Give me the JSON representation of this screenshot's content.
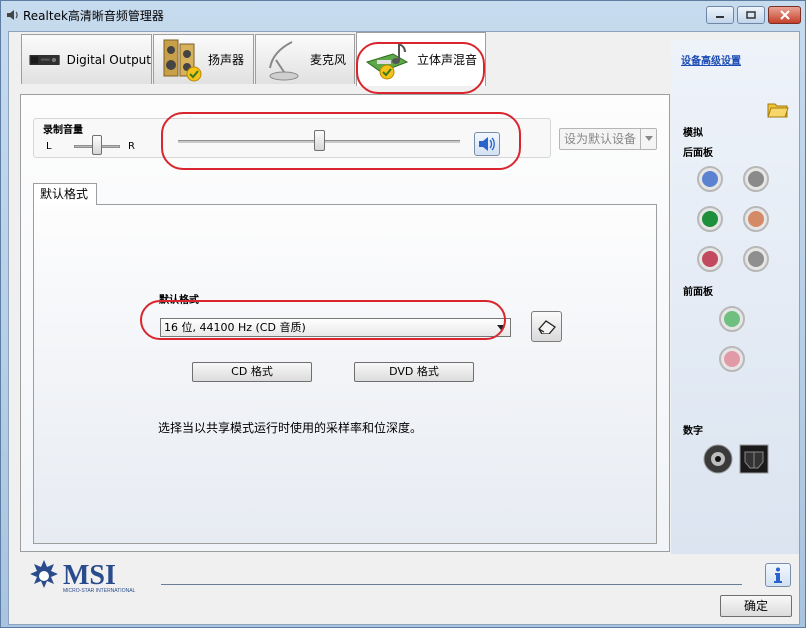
{
  "window": {
    "title": "Realtek高清晰音频管理器",
    "controls": [
      "minimize-icon",
      "maximize-icon",
      "close-icon"
    ]
  },
  "tabs": [
    {
      "label": "Digital Output",
      "icon": "digital-output-icon",
      "active": false
    },
    {
      "label": "扬声器",
      "icon": "speaker-icon",
      "active": false
    },
    {
      "label": "麦克风",
      "icon": "microphone-icon",
      "active": false
    },
    {
      "label": "立体声混音",
      "icon": "stereo-mix-icon",
      "active": true
    }
  ],
  "record": {
    "title": "录制音量",
    "left_label": "L",
    "right_label": "R",
    "balance": 0.5,
    "volume": 0.5,
    "default_device_label": "设为默认设备"
  },
  "format": {
    "tab_label": "默认格式",
    "label": "默认格式",
    "selected": "16 位, 44100 Hz (CD 音质)",
    "cd_button": "CD 格式",
    "dvd_button": "DVD 格式",
    "help": "选择当以共享模式运行时使用的采样率和位深度。"
  },
  "side": {
    "link": "设备高级设置",
    "analog": "模拟",
    "back_panel": "后面板",
    "front_panel": "前面板",
    "digital": "数字",
    "back_jacks": [
      "#5b82d1",
      "#8a8a8a",
      "#1e8f3a",
      "#d48a66",
      "#c24a5e",
      "#8f8f8f"
    ],
    "front_jacks": [
      "#6fbf80",
      "#e39aa7"
    ]
  },
  "footer": {
    "brand": "MSI",
    "brand_sub": "MICRO-STAR INTERNATIONAL",
    "ok": "确定"
  },
  "colors": {
    "highlight": "#d9262e",
    "link": "#1b4bb4"
  }
}
